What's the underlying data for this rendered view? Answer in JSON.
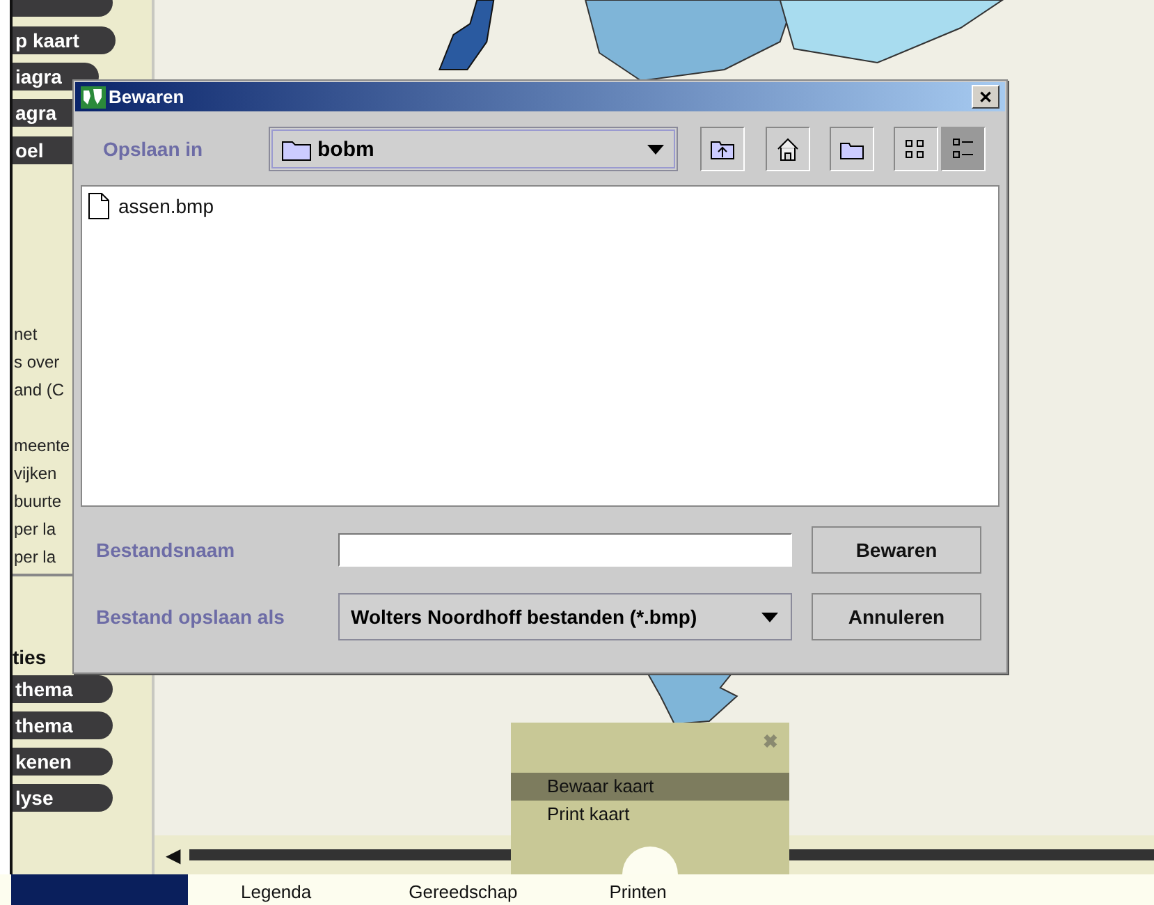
{
  "sidebar": {
    "top_buttons": [
      {
        "kind": "pill"
      },
      {
        "label": "p kaart",
        "kind": "pill"
      },
      {
        "label": "iagra",
        "kind": "pill"
      },
      {
        "label": "agra",
        "kind": "pill"
      },
      {
        "label": "oel",
        "kind": "tab"
      }
    ],
    "info_groups": [
      [
        "net",
        "s over",
        "and (C"
      ],
      [
        "meente",
        "vijken",
        "buurte",
        "per la",
        "per la"
      ]
    ],
    "section_title": "ties",
    "bottom_buttons": [
      "thema",
      "thema",
      "kenen",
      "lyse"
    ]
  },
  "slider": {
    "arrow": "◀"
  },
  "bottom_tabs": [
    "Legenda",
    "Gereedschap",
    "Printen"
  ],
  "popup": {
    "close": "✖",
    "items": [
      {
        "label": "Bewaar kaart",
        "selected": true
      },
      {
        "label": "Print kaart",
        "selected": false
      }
    ]
  },
  "dialog": {
    "title": "Bewaren",
    "close": "✕",
    "look_in": {
      "label": "Opslaan in",
      "value": "bobm"
    },
    "toolbar": [
      {
        "kind": "up",
        "selected": false
      },
      {
        "kind": "home",
        "selected": false
      },
      {
        "kind": "newfolder",
        "selected": false
      },
      {
        "kind": "list",
        "selected": false
      },
      {
        "kind": "details",
        "selected": true
      }
    ],
    "files": [
      {
        "name": "assen.bmp"
      }
    ],
    "file_name": {
      "label": "Bestandsnaam"
    },
    "file_type": {
      "label": "Bestand opslaan als",
      "value": "Wolters Noordhoff bestanden (*.bmp)"
    },
    "buttons": [
      "Bewaren",
      "Annuleren"
    ]
  }
}
